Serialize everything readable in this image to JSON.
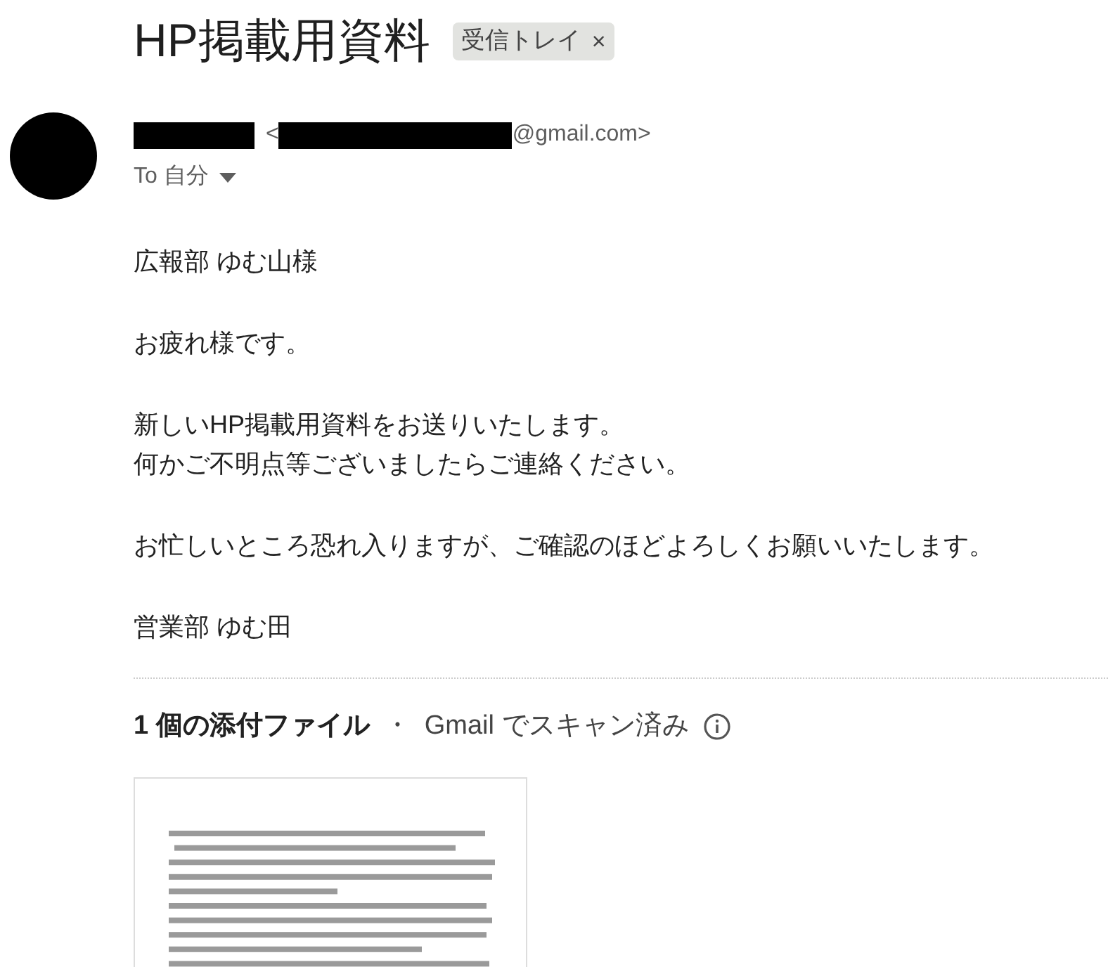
{
  "subject": "HP掲載用資料",
  "label_chip": {
    "text": "受信トレイ",
    "close": "×"
  },
  "sender": {
    "open_bracket": "<",
    "email_suffix": "@gmail.com>"
  },
  "recipient": {
    "text": "To 自分",
    "expanded": false
  },
  "body": [
    [
      "広報部 ゆむ山様"
    ],
    [
      "お疲れ様です。"
    ],
    [
      "新しいHP掲載用資料をお送りいたします。",
      "何かご不明点等ございましたらご連絡ください。"
    ],
    [
      "お忙しいところ恐れ入りますが、ご確認のほどよろしくお願いいたします。"
    ],
    [
      "営業部 ゆむ田"
    ]
  ],
  "attachments_header": {
    "count": "1 個の添付ファイル",
    "separator": "・",
    "scan": "Gmail でスキャン済み"
  },
  "attachments": [
    {
      "kind": "document"
    }
  ]
}
